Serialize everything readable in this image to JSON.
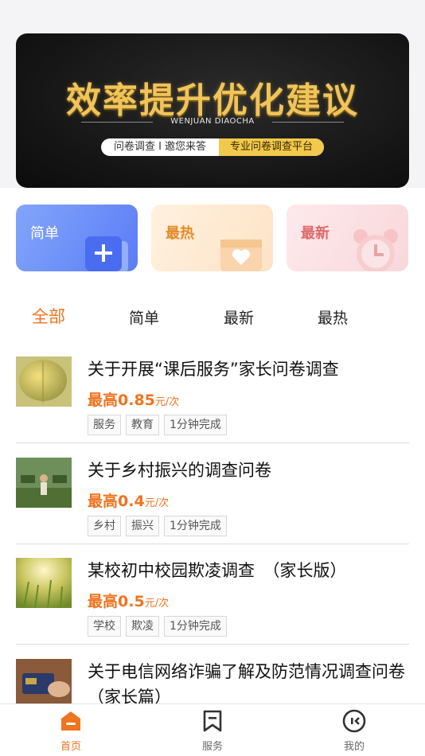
{
  "banner": {
    "title": "效率提升优化建议",
    "subtitle": "WENJUAN DIAOCHA",
    "pill_left": "问卷调查 I 邀您来答",
    "pill_right": "专业问卷调查平台"
  },
  "categories": [
    {
      "label": "简单",
      "icon": "add-doc-icon"
    },
    {
      "label": "最热",
      "icon": "heart-box-icon"
    },
    {
      "label": "最新",
      "icon": "alarm-clock-icon"
    }
  ],
  "tabs": [
    "全部",
    "简单",
    "最新",
    "最热"
  ],
  "active_tab": "全部",
  "surveys": [
    {
      "title": "关于开展“课后服务”家长问卷调查",
      "price_prefix": "最高",
      "price": "0.85",
      "unit": "元/次",
      "tags": [
        "服务",
        "教育",
        "1分钟完成"
      ]
    },
    {
      "title": "关于乡村振兴的调查问卷",
      "price_prefix": "最高",
      "price": "0.4",
      "unit": "元/次",
      "tags": [
        "乡村",
        "振兴",
        "1分钟完成"
      ]
    },
    {
      "title": "某校初中校园欺凌调查　（家长版）",
      "price_prefix": "最高",
      "price": "0.5",
      "unit": "元/次",
      "tags": [
        "学校",
        "欺凌",
        "1分钟完成"
      ]
    },
    {
      "title": "关于电信网络诈骗了解及防范情况调查问卷（家长篇）",
      "price_prefix": "",
      "price": "",
      "unit": "",
      "tags": []
    }
  ],
  "nav": [
    {
      "label": "首页",
      "icon": "home-icon",
      "active": true
    },
    {
      "label": "服务",
      "icon": "bookmark-icon",
      "active": false
    },
    {
      "label": "我的",
      "icon": "profile-face-icon",
      "active": false
    }
  ],
  "colors": {
    "accent": "#f0731f",
    "banner_gold": "#f0c45a",
    "blue_card": "#5b7cf6"
  }
}
